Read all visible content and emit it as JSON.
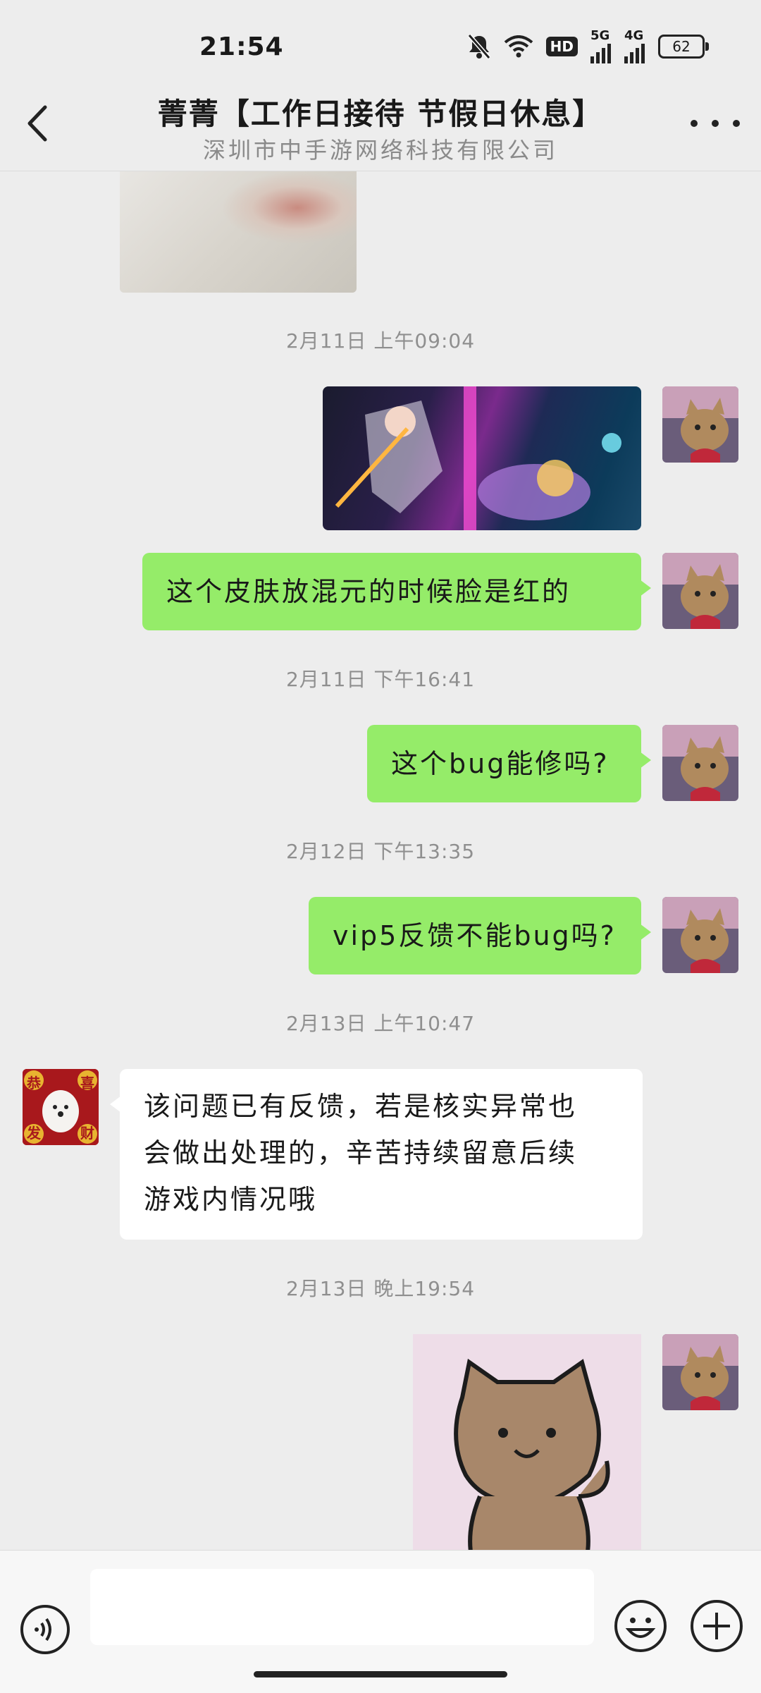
{
  "status_bar": {
    "time": "21:54",
    "hd_label": "HD",
    "network_1": "5G",
    "network_2": "4G",
    "battery": "62",
    "icons": [
      "mute-bell-icon",
      "wifi-icon",
      "hd-icon",
      "5g-signal-icon",
      "4g-signal-icon",
      "battery-icon"
    ]
  },
  "header": {
    "title": "菁菁【工作日接待 节假日休息】",
    "subtitle": "深圳市中手游网络科技有限公司",
    "back_icon": "chevron-left-icon",
    "more_icon": "more-dots-icon"
  },
  "messages": {
    "ts1": "2月11日 上午09:04",
    "ts2": "2月11日 下午16:41",
    "ts3": "2月12日 下午13:35",
    "ts4": "2月13日 上午10:47",
    "ts5": "2月13日 晚上19:54",
    "msg1": "这个皮肤放混元的时候脸是红的",
    "msg2": "这个bug能修吗?",
    "msg3": "vip5反馈不能bug吗?",
    "reply1_line1": "该问题已有反馈，若是核实异常也",
    "reply1_line2": "会做出处理的，辛苦持续留意后续",
    "reply1_line3": "游戏内情况哦",
    "agent_avatar_text": [
      "恭",
      "喜",
      "发",
      "财"
    ]
  },
  "input_bar": {
    "placeholder": "",
    "icons": [
      "voice-icon",
      "emoji-icon",
      "plus-icon"
    ]
  },
  "colors": {
    "background": "#EDEDED",
    "outgoing_bubble": "#95EC69",
    "incoming_bubble": "#FFFFFF",
    "timestamp": "#8F8F8F"
  }
}
